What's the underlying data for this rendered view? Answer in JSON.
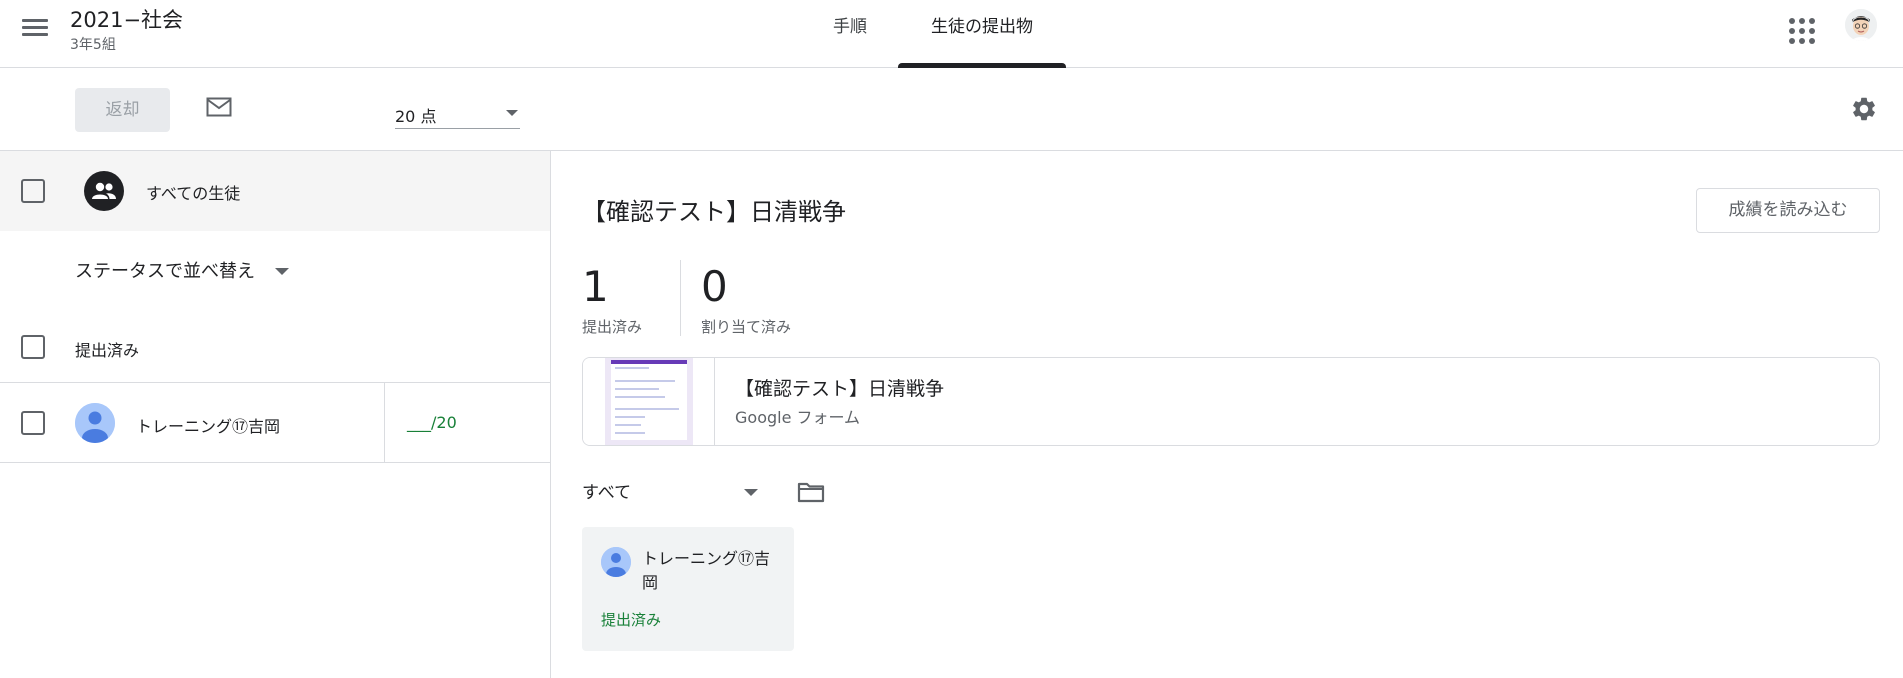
{
  "header": {
    "class_title": "2021−社会",
    "class_subtitle": "3年5組",
    "tabs": [
      {
        "label": "手順",
        "active": false
      },
      {
        "label": "生徒の提出物",
        "active": true
      }
    ]
  },
  "toolbar": {
    "return_label": "返却",
    "points_value": "20 点"
  },
  "left_panel": {
    "all_students_label": "すべての生徒",
    "sort_label": "ステータスで並べ替え",
    "section_label": "提出済み",
    "students": [
      {
        "name": "トレーニング⑰吉岡",
        "grade": "___/20"
      }
    ]
  },
  "assignment": {
    "title": "【確認テスト】日清戦争",
    "import_grades_label": "成績を読み込む",
    "stats": [
      {
        "value": "1",
        "label": "提出済み"
      },
      {
        "value": "0",
        "label": "割り当て済み"
      }
    ],
    "attachment": {
      "title": "【確認テスト】日清戦争",
      "type": "Google フォーム"
    },
    "filter_label": "すべて",
    "work_cards": [
      {
        "name": "トレーニング⑰吉岡",
        "status": "提出済み"
      }
    ]
  },
  "colors": {
    "accent_text": "#202124",
    "status_green": "#188038",
    "divider": "#dadce0",
    "form_purple": "#673ab7"
  },
  "icons": [
    "menu-icon",
    "apps-icon",
    "mail-icon",
    "settings-icon",
    "people-icon",
    "person-icon",
    "folder-icon",
    "dropdown-arrow-icon"
  ]
}
